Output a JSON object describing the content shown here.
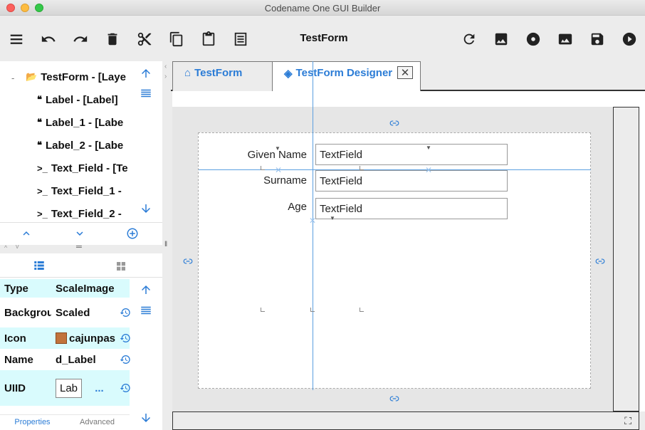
{
  "window": {
    "title": "Codename One GUI Builder"
  },
  "toolbar": {
    "form_title": "TestForm",
    "buttons": [
      "menu-icon",
      "undo-icon",
      "redo-icon",
      "delete-icon",
      "cut-icon",
      "copy-icon",
      "paste-icon",
      "list-icon",
      "refresh-icon",
      "image-icon",
      "disc-icon",
      "picture-icon",
      "save-icon",
      "play-icon"
    ]
  },
  "tree": {
    "collapse_marker": "-",
    "items": [
      {
        "label": "TestForm - [Laye",
        "icon": "folder-icon"
      },
      {
        "label": "Label - [Label]",
        "icon": "quote-icon"
      },
      {
        "label": "Label_1 - [Labe",
        "icon": "quote-icon"
      },
      {
        "label": "Label_2 - [Labe",
        "icon": "quote-icon"
      },
      {
        "label": "Text_Field - [Te",
        "icon": "terminal-icon"
      },
      {
        "label": "Text_Field_1 - ",
        "icon": "terminal-icon"
      },
      {
        "label": "Text_Field_2 - ",
        "icon": "terminal-icon"
      }
    ]
  },
  "properties": {
    "rows": [
      {
        "key": "Type",
        "value": "ScaleImage"
      },
      {
        "key": "Backgrou",
        "value": "Scaled"
      },
      {
        "key": "Icon",
        "value": "cajunpas"
      },
      {
        "key": "Name",
        "value": "d_Label"
      },
      {
        "key": "UIID",
        "value": "Lab",
        "extra": "..."
      }
    ],
    "tabs": {
      "properties": "Properties",
      "advanced": "Advanced"
    }
  },
  "editor": {
    "tabs": [
      {
        "label": "TestForm",
        "icon": "home-icon"
      },
      {
        "label": "TestForm Designer",
        "icon": "layers-icon",
        "close": "✕"
      }
    ],
    "form": {
      "fields": [
        {
          "label": "Given Name",
          "value": "TextField"
        },
        {
          "label": "Surname",
          "value": "TextField"
        },
        {
          "label": "Age",
          "value": "TextField"
        }
      ]
    }
  },
  "colors": {
    "accent": "#2b7cd6",
    "selected_row": "#d9fbfd",
    "guide": "#5b9fe0"
  }
}
